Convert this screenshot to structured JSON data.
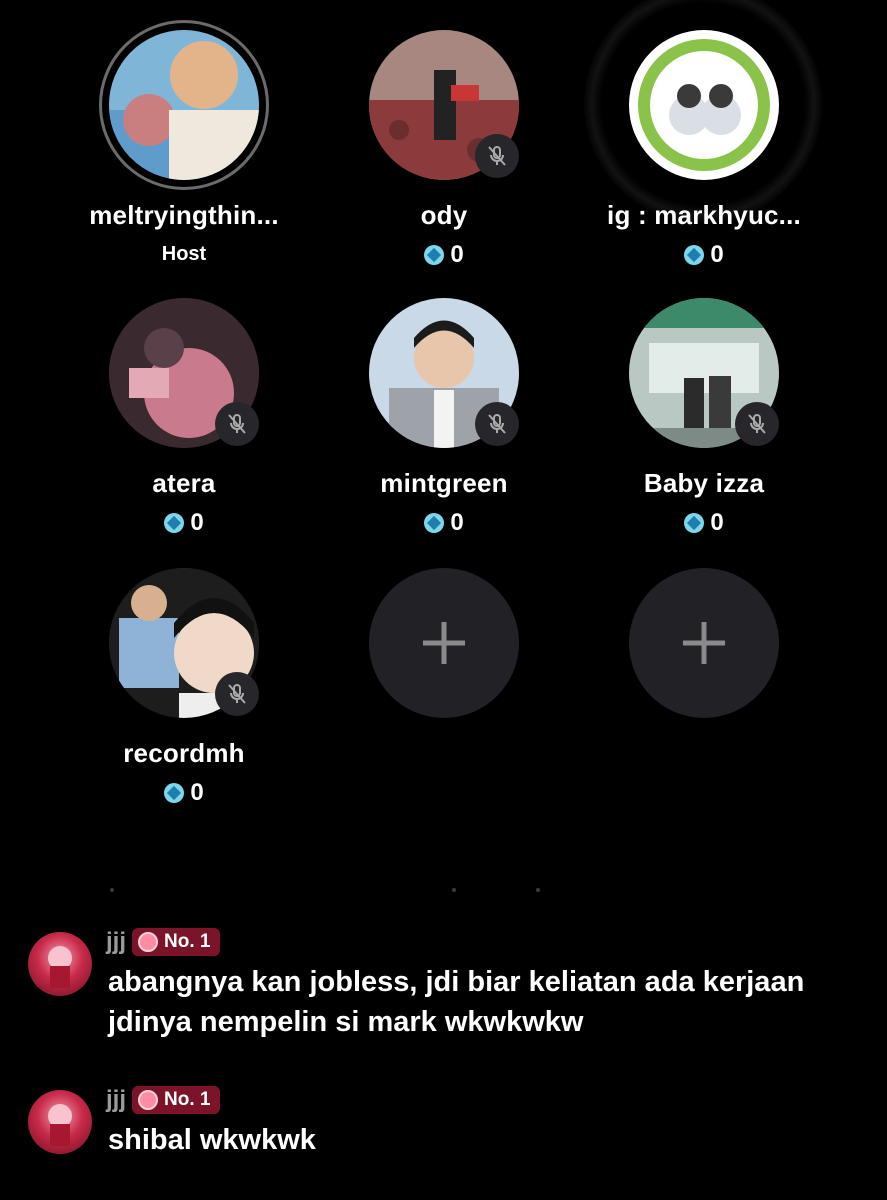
{
  "seats": [
    {
      "username": "meltryingthin...",
      "role": "Host",
      "muted": false
    },
    {
      "username": "ody",
      "score": "0",
      "muted": true
    },
    {
      "username": "ig : markhyuc...",
      "score": "0",
      "muted": false
    },
    {
      "username": "atera",
      "score": "0",
      "muted": true
    },
    {
      "username": "mintgreen",
      "score": "0",
      "muted": true
    },
    {
      "username": "Baby izza",
      "score": "0",
      "muted": true
    },
    {
      "username": "recordmh",
      "score": "0",
      "muted": true
    }
  ],
  "empty_seat_icon": "plus-icon",
  "comments": [
    {
      "user": "jjj",
      "badge": "No. 1",
      "text": "abangnya kan jobless, jdi biar keliatan ada kerjaan jdinya nempelin si mark wkwkwkw"
    },
    {
      "user": "jjj",
      "badge": "No. 1",
      "text": "shibal wkwkwk"
    }
  ],
  "colors": {
    "background": "#000000",
    "badge": "#7c1429",
    "gem": "#7fd6ea",
    "mute_badge": "#26262b",
    "empty_seat": "#222226"
  }
}
